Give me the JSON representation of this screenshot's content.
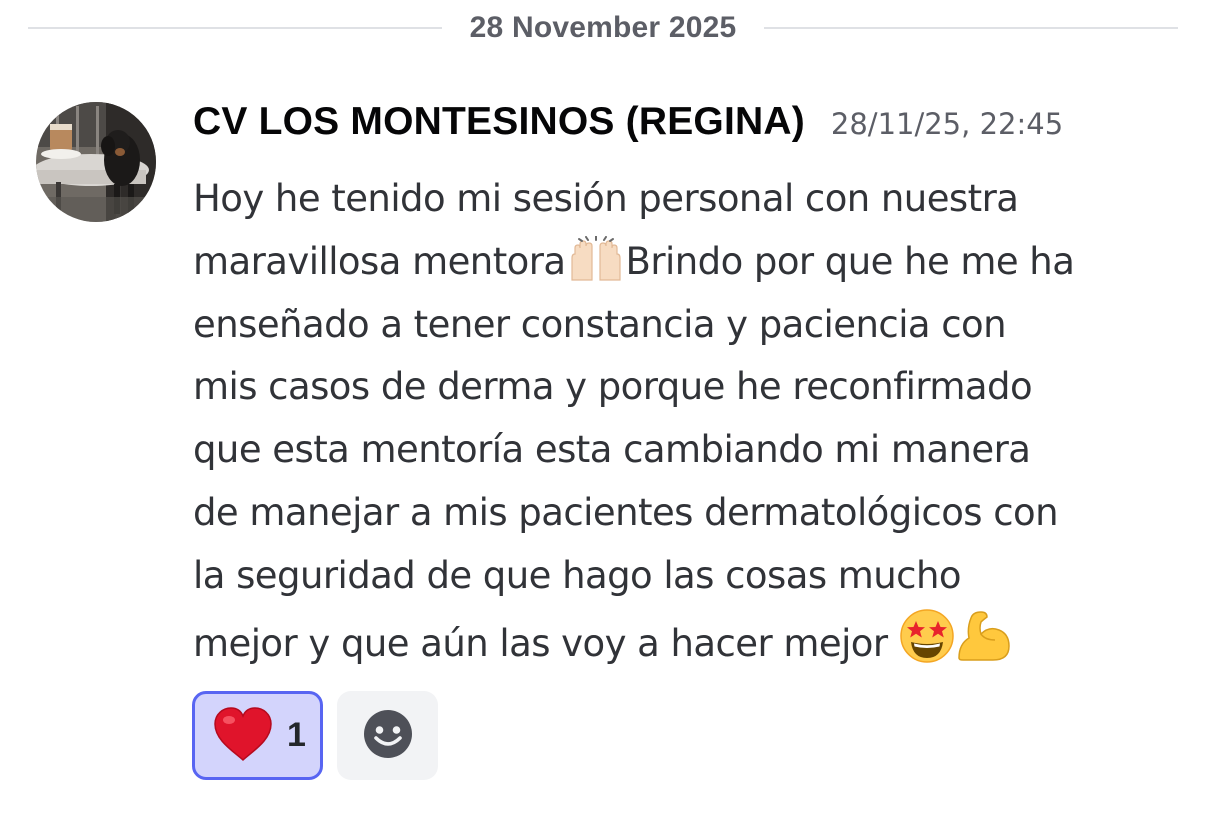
{
  "divider": {
    "date": "28 November 2025"
  },
  "message": {
    "author": "CV LOS MONTESINOS (REGINA)",
    "timestamp": "28/11/25, 22:45",
    "lines": {
      "l1": "Hoy he tenido mi sesión personal con nuestra",
      "l2a": "maravillosa mentora",
      "l2b": "Brindo por que he me ha",
      "l3": "enseñado a tener constancia y paciencia con",
      "l4": "mis casos de derma y porque he reconfirmado",
      "l5": "que esta mentoría esta cambiando mi manera",
      "l6": "de manejar a mis pacientes dermatológicos con",
      "l7": "la seguridad de que hago las cosas mucho",
      "l8": "mejor y que aún las voy a hacer mejor "
    },
    "emojis": [
      "raising-hands-emoji",
      "star-struck-emoji",
      "flexed-biceps-emoji"
    ]
  },
  "reactions": [
    {
      "emoji": "red-heart-emoji",
      "count": "1",
      "selected": true
    }
  ],
  "colors": {
    "accent": "#5865f2",
    "reaction_bg": "#d3d4fc",
    "text": "#313338",
    "muted": "#5c5e66"
  }
}
